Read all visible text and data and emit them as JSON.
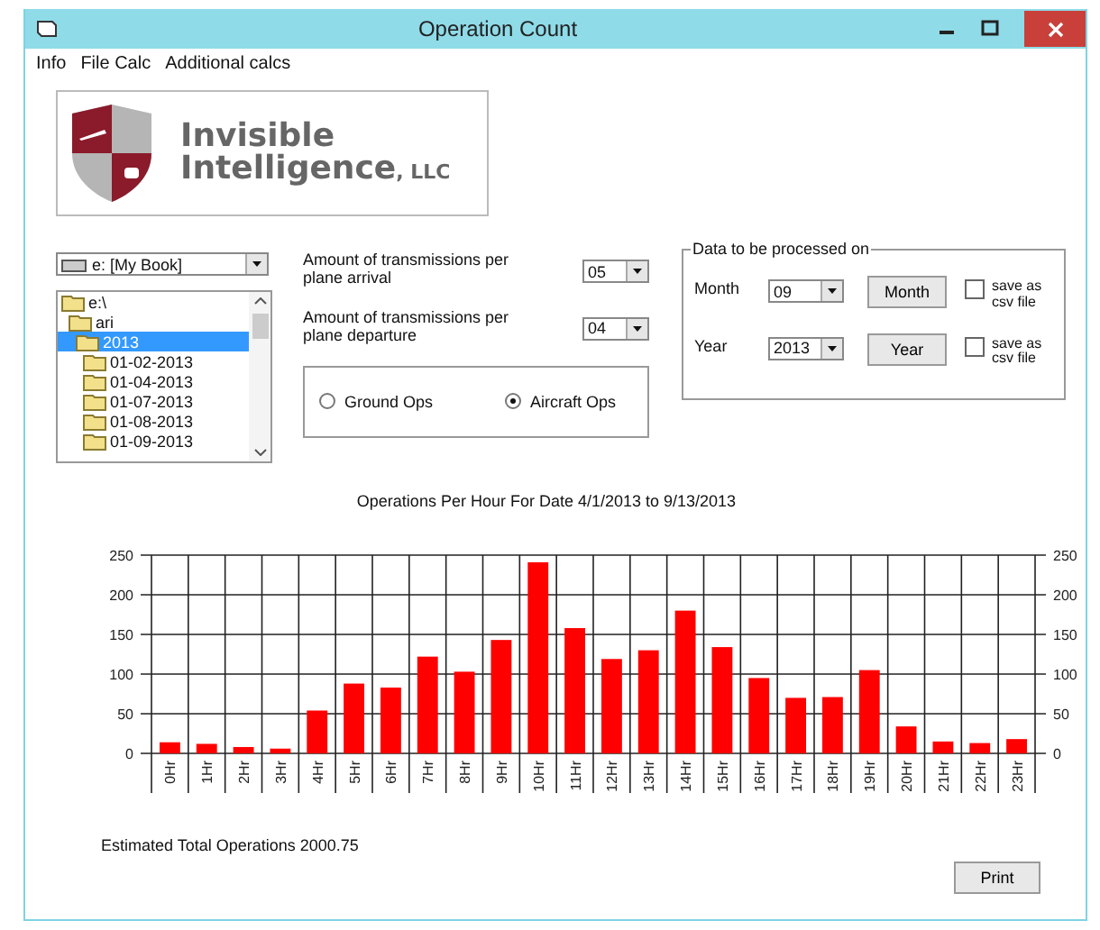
{
  "window": {
    "title": "Operation Count"
  },
  "menu": [
    "Info",
    "File Calc",
    "Additional calcs"
  ],
  "logo": {
    "line1": "Invisible",
    "line2": "Intelligence",
    "suffix": ", LLC"
  },
  "drive": {
    "value": "e: [My Book]"
  },
  "folders": [
    {
      "label": "e:\\",
      "selected": false,
      "children": [
        {
          "label": "ari",
          "selected": false,
          "children": [
            {
              "label": "2013",
              "selected": true,
              "children": [
                {
                  "label": "01-02-2013",
                  "selected": false
                },
                {
                  "label": "01-04-2013",
                  "selected": false
                },
                {
                  "label": "01-07-2013",
                  "selected": false
                },
                {
                  "label": "01-08-2013",
                  "selected": false
                },
                {
                  "label": "01-09-2013",
                  "selected": false
                }
              ]
            }
          ]
        }
      ]
    }
  ],
  "transmissions": [
    {
      "label": "Amount of transmissions per plane arrival",
      "value": "05"
    },
    {
      "label": "Amount of transmissions per plane departure",
      "value": "04"
    }
  ],
  "ops": [
    {
      "label": "Ground Ops",
      "selected": false
    },
    {
      "label": "Aircraft Ops",
      "selected": true
    }
  ],
  "process": {
    "legend": "Data to be processed on",
    "rows": [
      {
        "label": "Month",
        "value": "09",
        "button": "Month",
        "checkbox": "save as csv file",
        "checked": false
      },
      {
        "label": "Year",
        "value": "2013",
        "button": "Year",
        "checkbox": "save as csv file",
        "checked": false
      }
    ]
  },
  "chart": {
    "chart_data": {
      "type": "bar",
      "title": "Operations Per Hour For Date 4/1/2013 to 9/13/2013",
      "categories": [
        "0Hr",
        "1Hr",
        "2Hr",
        "3Hr",
        "4Hr",
        "5Hr",
        "6Hr",
        "7Hr",
        "8Hr",
        "9Hr",
        "10Hr",
        "11Hr",
        "12Hr",
        "13Hr",
        "14Hr",
        "15Hr",
        "16Hr",
        "17Hr",
        "18Hr",
        "19Hr",
        "20Hr",
        "21Hr",
        "22Hr",
        "23Hr"
      ],
      "series": [
        {
          "color": "#ff0000",
          "values": [
            14,
            12,
            8,
            6,
            54,
            88,
            83,
            122,
            103,
            143,
            241,
            158,
            119,
            130,
            180,
            134,
            95,
            70,
            71,
            105,
            34,
            15,
            13,
            18
          ]
        }
      ],
      "ylim": [
        0,
        250
      ],
      "yticks": [
        0,
        50,
        100,
        150,
        200,
        250
      ],
      "y2ticks": [
        0,
        50,
        100,
        150,
        200,
        250
      ],
      "y2lim": [
        0,
        250
      ],
      "grid": true
    }
  },
  "total": "Estimated Total Operations 2000.75",
  "buttons": [
    "Print"
  ]
}
